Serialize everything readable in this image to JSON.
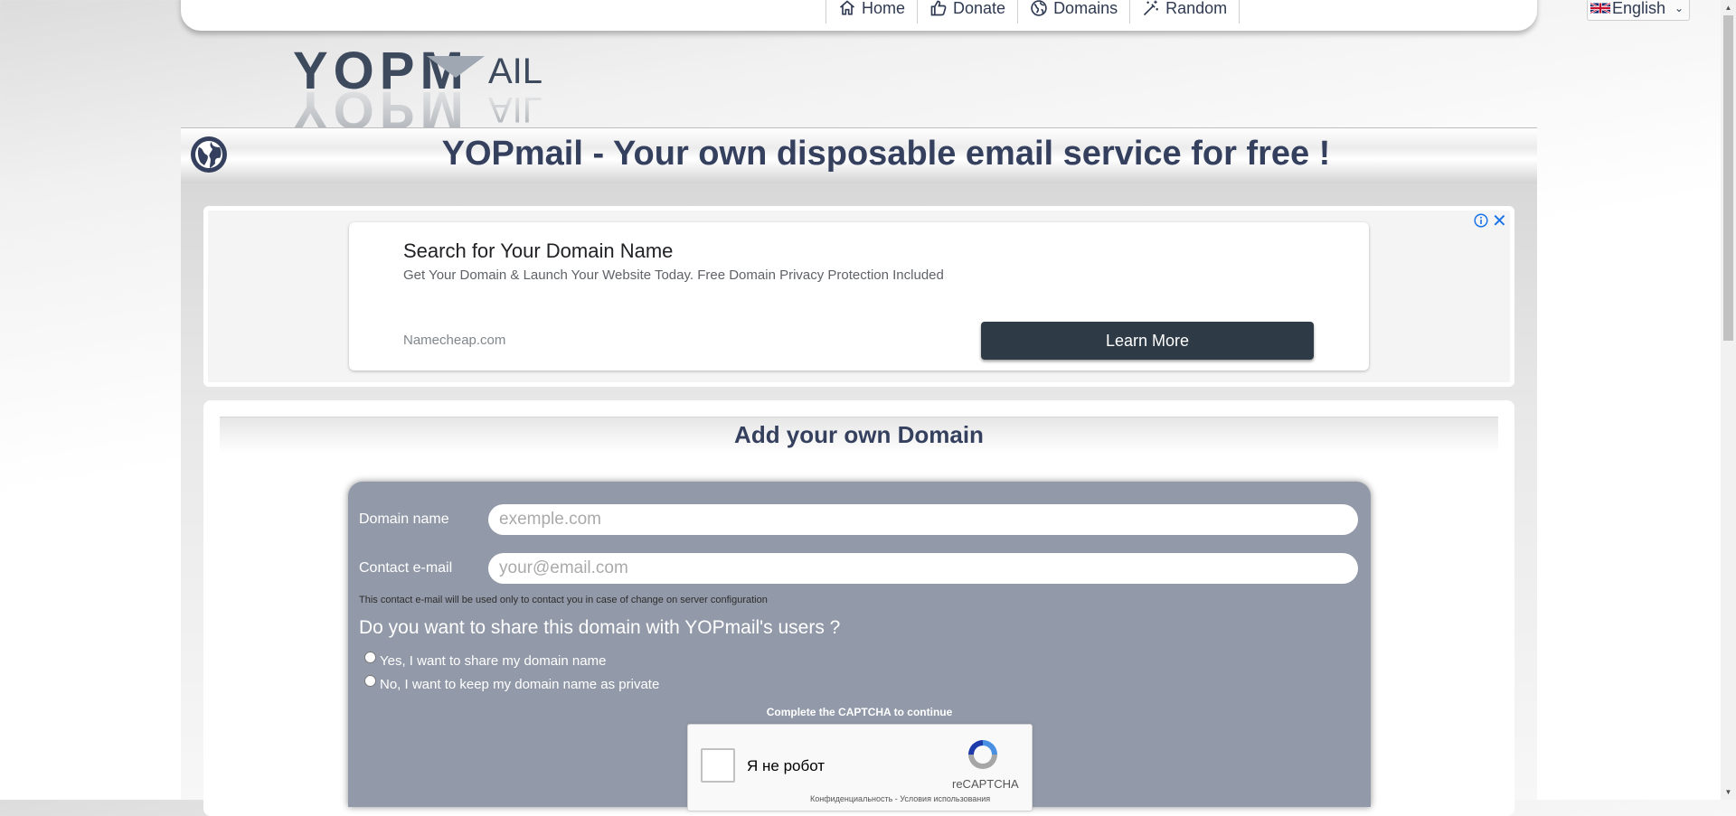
{
  "nav": {
    "items": [
      {
        "label": "Home",
        "icon": "home-icon"
      },
      {
        "label": "Donate",
        "icon": "thumbs-up-icon"
      },
      {
        "label": "Domains",
        "icon": "globe-icon"
      },
      {
        "label": "Random",
        "icon": "magic-wand-icon"
      }
    ],
    "active": "Donate",
    "language": "English"
  },
  "logo": {
    "text": "YOPMAIL"
  },
  "banner": {
    "title": "YOPmail - Your own disposable email service for free !"
  },
  "ad": {
    "title": "Search for Your Domain Name",
    "description": "Get Your Domain & Launch Your Website Today. Free Domain Privacy Protection Included",
    "domain": "Namecheap.com",
    "cta": "Learn More"
  },
  "section": {
    "title": "Add your own Domain"
  },
  "form": {
    "domain_label": "Domain name",
    "domain_placeholder": "exemple.com",
    "email_label": "Contact e-mail",
    "email_placeholder": "your@email.com",
    "contact_note": "This contact e-mail will be used only to contact you in case of change on server configuration",
    "share_question": "Do you want to share this domain with YOPmail's users ?",
    "option_share": "Yes, I want to share my domain name",
    "option_private": "No, I want to keep my domain name as private",
    "captcha_note": "Complete the CAPTCHA to continue"
  },
  "captcha": {
    "label": "Я не робот",
    "brand": "reCAPTCHA",
    "links": "Конфиденциальность - Условия использования"
  },
  "colors": {
    "title": "#34405e",
    "form_bg": "#9299a8",
    "ad_button": "#2e3a45"
  }
}
